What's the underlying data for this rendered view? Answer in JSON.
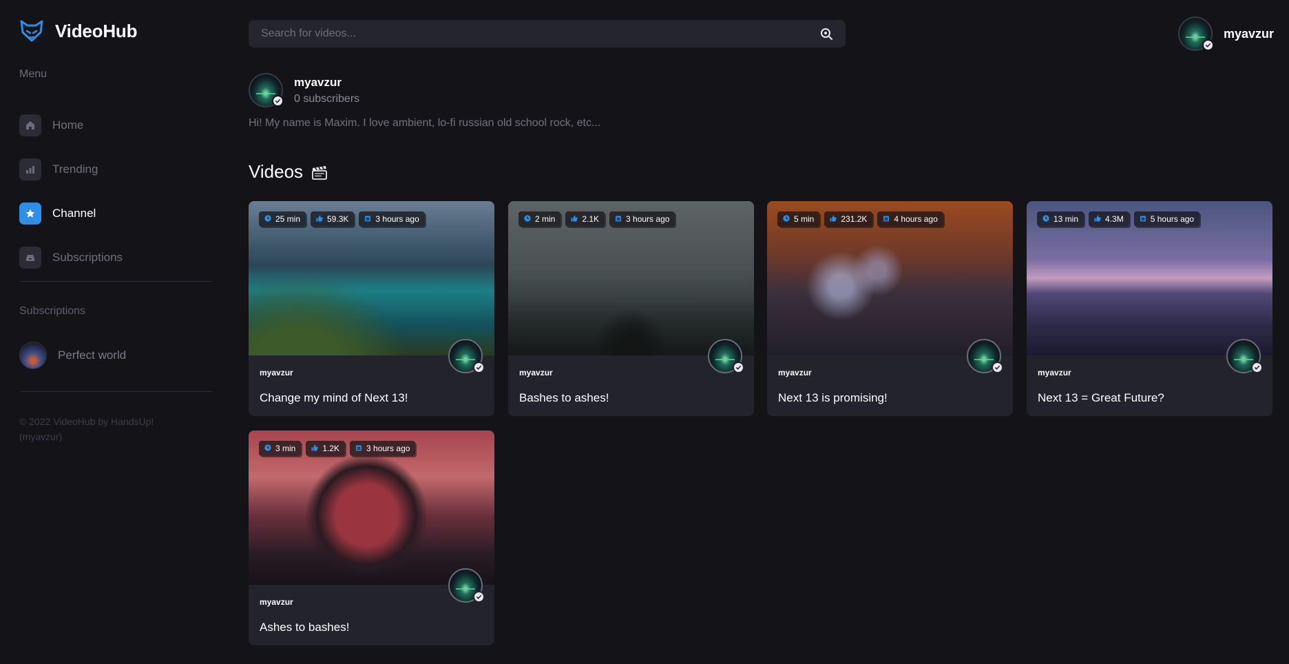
{
  "app": {
    "name": "VideoHub"
  },
  "sidebar": {
    "menu_label": "Menu",
    "items": [
      {
        "label": "Home",
        "icon": "home-icon",
        "active": false
      },
      {
        "label": "Trending",
        "icon": "chart-icon",
        "active": false
      },
      {
        "label": "Channel",
        "icon": "star-icon",
        "active": true
      },
      {
        "label": "Subscriptions",
        "icon": "inbox-icon",
        "active": false
      }
    ],
    "subscriptions_label": "Subscriptions",
    "subscriptions": [
      {
        "name": "Perfect world"
      }
    ],
    "copyright": "© 2022 VideoHub by HandsUp! (myavzur)"
  },
  "search": {
    "placeholder": "Search for videos..."
  },
  "user": {
    "name": "myavzur"
  },
  "channel": {
    "name": "myavzur",
    "subscribers": "0 subscribers",
    "description": "Hi! My name is Maxim. I love ambient, lo-fi russian old school rock, etc..."
  },
  "videos_section": {
    "title": "Videos",
    "icon": "clapperboard-icon"
  },
  "videos": [
    {
      "duration": "25 min",
      "likes": "59.3K",
      "uploaded": "3 hours ago",
      "channel": "myavzur",
      "title": "Change my mind of Next 13!"
    },
    {
      "duration": "2 min",
      "likes": "2.1K",
      "uploaded": "3 hours ago",
      "channel": "myavzur",
      "title": "Bashes to ashes!"
    },
    {
      "duration": "5 min",
      "likes": "231.2K",
      "uploaded": "4 hours ago",
      "channel": "myavzur",
      "title": "Next 13 is promising!"
    },
    {
      "duration": "13 min",
      "likes": "4.3M",
      "uploaded": "5 hours ago",
      "channel": "myavzur",
      "title": "Next 13 = Great Future?"
    },
    {
      "duration": "3 min",
      "likes": "1.2K",
      "uploaded": "3 hours ago",
      "channel": "myavzur",
      "title": "Ashes to bashes!"
    }
  ],
  "colors": {
    "accent": "#2f8fe6",
    "background": "#131318",
    "card": "#22232b"
  }
}
